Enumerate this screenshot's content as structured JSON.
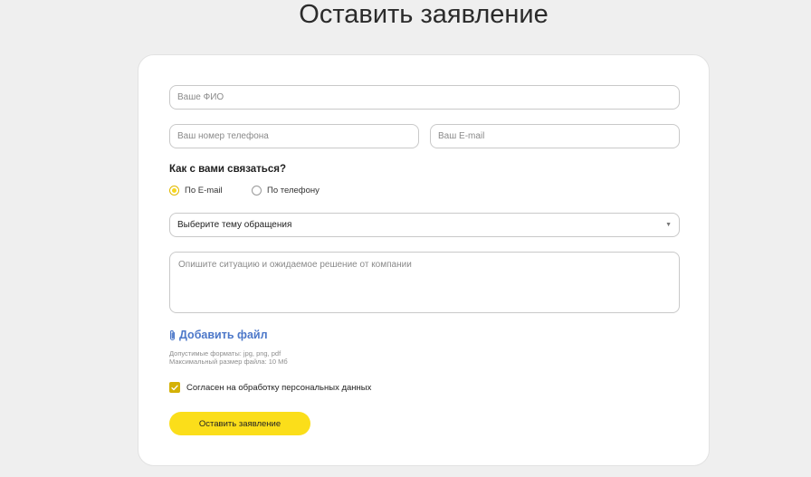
{
  "page": {
    "title": "Оставить заявление"
  },
  "form": {
    "fio_placeholder": "Ваше ФИО",
    "phone_placeholder": "Ваш номер телефона",
    "email_placeholder": "Ваш E-mail",
    "contact_label": "Как с вами связаться?",
    "contact_options": [
      {
        "label": "По E-mail",
        "selected": true
      },
      {
        "label": "По телефону",
        "selected": false
      }
    ],
    "topic_select": {
      "selected": "Выберите тему обращения",
      "icon": "chevron-down-icon"
    },
    "description_placeholder": "Опишите ситуацию и ожидаемое решение от компании",
    "add_file": {
      "label": "Добавить файл",
      "icon": "paperclip-icon"
    },
    "file_hints": [
      "Допустимые форматы: jpg, png, pdf",
      "Максимальный размер файла: 10 Мб"
    ],
    "consent": {
      "label": "Согласен на обработку персональных данных",
      "checked": true
    },
    "submit_label": "Оставить заявление"
  },
  "colors": {
    "accent_yellow": "#fbde1a",
    "checkbox_yellow": "#d4b106",
    "link_blue": "#4d78c9",
    "background": "#efefef"
  }
}
